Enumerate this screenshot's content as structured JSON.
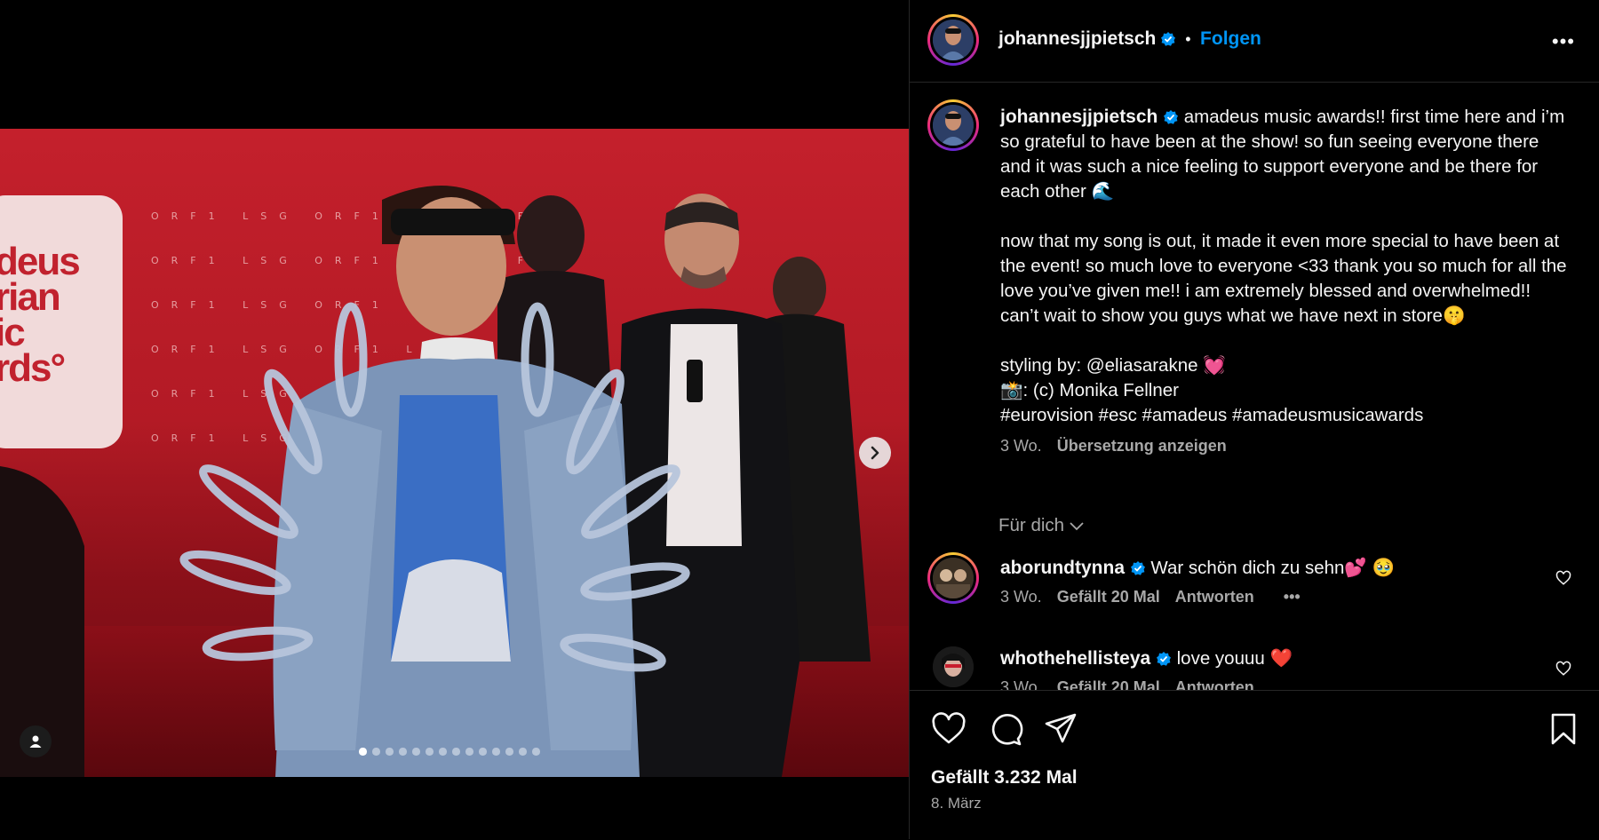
{
  "post": {
    "username": "johannesjjpietsch",
    "follow_label": "Folgen",
    "more_label": "•••",
    "dot_separator": "•"
  },
  "caption": {
    "username": "johannesjjpietsch",
    "line1": "amadeus music awards!! first time here and i’m so grateful to have been at the show! so fun seeing everyone there and it was such a nice feeling to support everyone and be there for each other 🌊",
    "line2": "now that my song is out, it made it even more special to have been at the event! so much love to everyone <33 thank you so much for all the love you’ve given me!! i am extremely blessed and overwhelmed!! can’t wait to show you guys what we have next in store🤫",
    "line3": "styling by: @eliasarakne 💓",
    "line4": "📸: (c) Monika Fellner",
    "line5": "#eurovision #esc #amadeus #amadeusmusicawards",
    "time": "3 Wo.",
    "translate": "Übersetzung anzeigen"
  },
  "filter": {
    "label": "Für dich"
  },
  "comments": [
    {
      "username": "aborundtynna",
      "text": "War schön dich zu sehn💕 🥹",
      "time": "3 Wo.",
      "likes": "Gefällt 20 Mal",
      "reply": "Antworten",
      "more": "•••"
    },
    {
      "username": "whothehellisteya",
      "text": "love youuu ❤️",
      "time": "3 Wo.",
      "likes": "Gefällt 20 Mal",
      "reply": "Antworten"
    }
  ],
  "footer": {
    "likes": "Gefällt 3.232 Mal",
    "date": "8. März"
  },
  "photo": {
    "sign_text": "deus\nrian\nic\nrds°",
    "logo_text": "ORF1  LSG  ORF1  LSG  ORF1"
  },
  "carousel": {
    "total": 14,
    "active": 0
  },
  "colors": {
    "accent": "#0095f6",
    "background": "#000000",
    "backdrop": "#c4202c",
    "heart": "#ed4956"
  },
  "icons": [
    "verified-icon",
    "more-icon",
    "heart-icon",
    "comment-icon",
    "share-icon",
    "bookmark-icon",
    "next-arrow-icon",
    "user-tag-icon",
    "chevron-down-icon"
  ]
}
